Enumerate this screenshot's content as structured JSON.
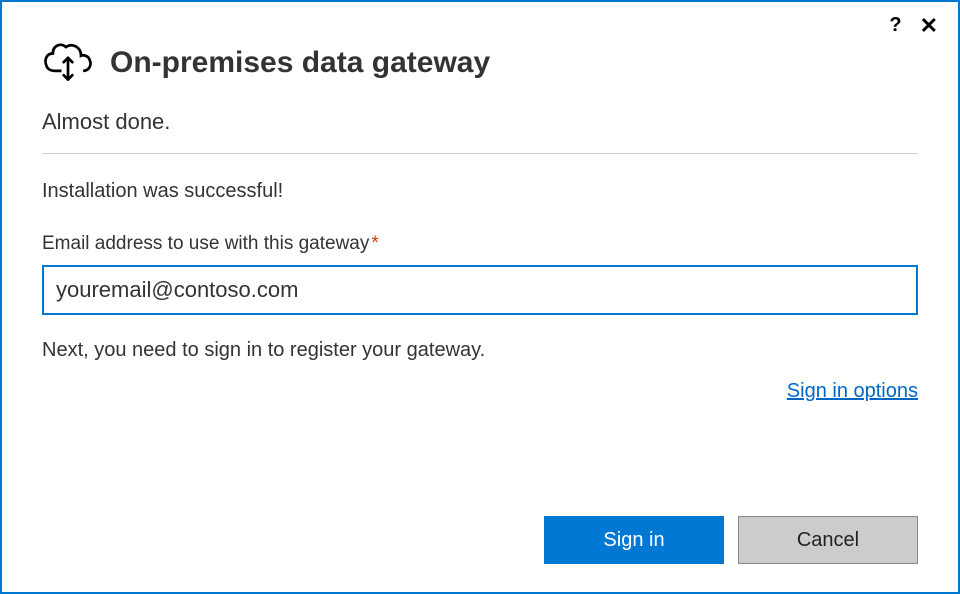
{
  "header": {
    "title": "On-premises data gateway",
    "icon_name": "cloud-sync-icon"
  },
  "subtitle": "Almost done.",
  "body": {
    "success_message": "Installation was successful!",
    "email_label": "Email address to use with this gateway",
    "required_marker": "*",
    "email_value": "youremail@contoso.com",
    "instruction": "Next, you need to sign in to register your gateway.",
    "signin_options_link": "Sign in options"
  },
  "buttons": {
    "primary": "Sign in",
    "secondary": "Cancel"
  },
  "titlebar": {
    "help_glyph": "?",
    "close_glyph": "✕"
  }
}
